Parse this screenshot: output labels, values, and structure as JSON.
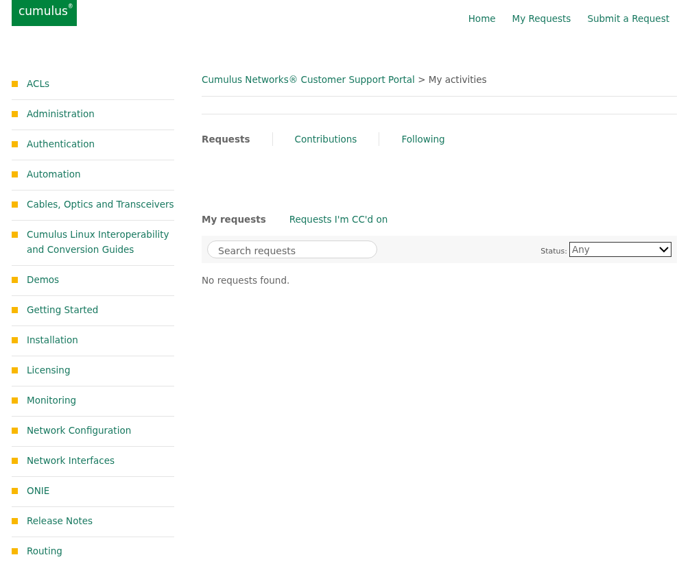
{
  "logo": {
    "text": "cumulus",
    "mark": "®"
  },
  "nav": [
    "Home",
    "My Requests",
    "Submit a Request"
  ],
  "sidebar": {
    "items": [
      "ACLs",
      "Administration",
      "Authentication",
      "Automation",
      "Cables, Optics and Transceivers",
      "Cumulus Linux Interoperability and Conversion Guides",
      "Demos",
      "Getting Started",
      "Installation",
      "Licensing",
      "Monitoring",
      "Network Configuration",
      "Network Interfaces",
      "ONIE",
      "Release Notes",
      "Routing"
    ]
  },
  "breadcrumb": {
    "link": "Cumulus Networks® Customer Support Portal",
    "separator": ">",
    "current": "My activities"
  },
  "tabs": [
    {
      "label": "Requests",
      "selected": true
    },
    {
      "label": "Contributions",
      "selected": false
    },
    {
      "label": "Following",
      "selected": false
    }
  ],
  "subtabs": [
    {
      "label": "My requests",
      "selected": true
    },
    {
      "label": "Requests I'm CC'd on",
      "selected": false
    }
  ],
  "search": {
    "placeholder": "Search requests"
  },
  "status": {
    "label": "Status:",
    "value": "Any"
  },
  "empty_message": "No requests found."
}
